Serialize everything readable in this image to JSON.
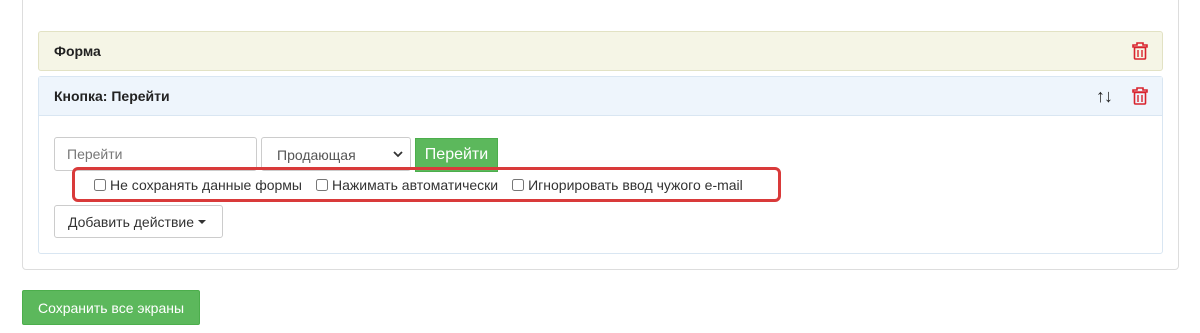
{
  "form_panel": {
    "title": "Форма",
    "delete_icon": "trash-icon"
  },
  "button_panel": {
    "title": "Кнопка: Перейти",
    "move_arrows": "↑↓",
    "delete_icon": "trash-icon",
    "text_input": {
      "value": "",
      "placeholder": "Перейти"
    },
    "select": {
      "selected": "Продающая"
    },
    "go_button_label": "Перейти",
    "checkboxes": [
      {
        "label": "Не сохранять данные формы",
        "checked": false
      },
      {
        "label": "Нажимать автоматически",
        "checked": false
      },
      {
        "label": "Игнорировать ввод чужого e-mail",
        "checked": false
      }
    ],
    "add_action_label": "Добавить действие"
  },
  "save_all_label": "Сохранить все экраны",
  "colors": {
    "success": "#5cb85c",
    "danger": "#d9232d",
    "highlight": "#d93a3a",
    "form_header_bg": "#f5f5e6",
    "button_header_bg": "#eef5fc"
  }
}
